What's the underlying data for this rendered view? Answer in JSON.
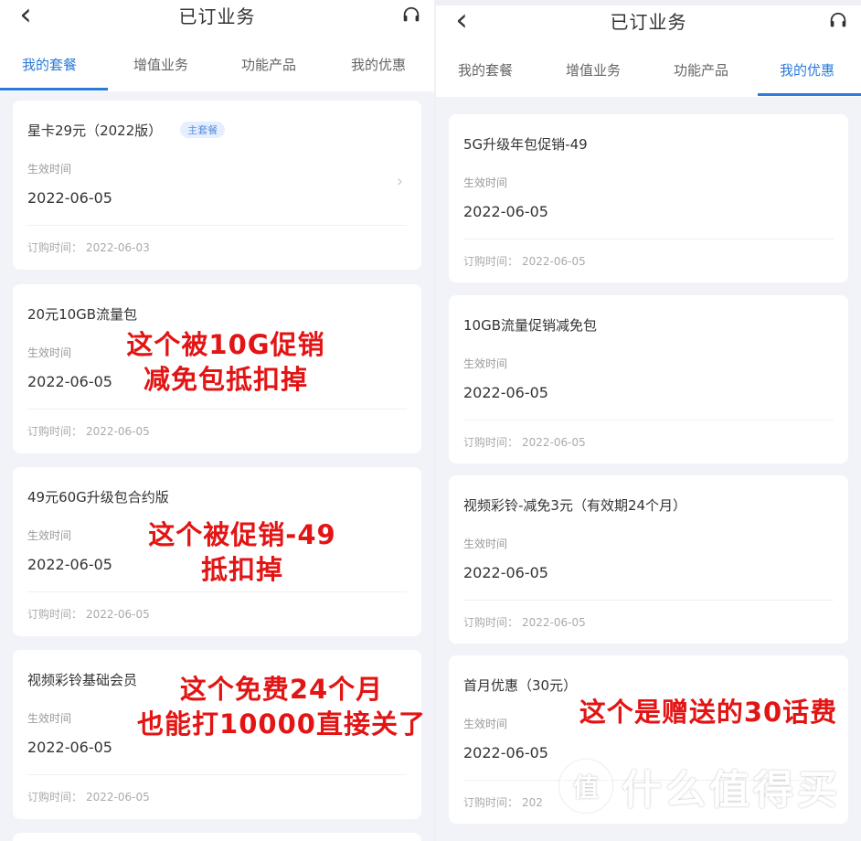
{
  "left": {
    "title": "已订业务",
    "tabs": [
      "我的套餐",
      "增值业务",
      "功能产品",
      "我的优惠"
    ],
    "active_tab": 0,
    "cards": [
      {
        "name": "星卡29元（2022版）",
        "badge": "主套餐",
        "effective_label": "生效时间",
        "effective_date": "2022-06-05",
        "order_label": "订购时间：",
        "order_date": "2022-06-03"
      },
      {
        "name": "20元10GB流量包",
        "effective_label": "生效时间",
        "effective_date": "2022-06-05",
        "order_label": "订购时间：",
        "order_date": "2022-06-05"
      },
      {
        "name": "49元60G升级包合约版",
        "effective_label": "生效时间",
        "effective_date": "2022-06-05",
        "order_label": "订购时间：",
        "order_date": "2022-06-05"
      },
      {
        "name": "视频彩铃基础会员",
        "effective_label": "生效时间",
        "effective_date": "2022-06-05",
        "order_label": "订购时间：",
        "order_date": "2022-06-05"
      }
    ]
  },
  "right": {
    "title": "已订业务",
    "tabs": [
      "我的套餐",
      "增值业务",
      "功能产品",
      "我的优惠"
    ],
    "active_tab": 3,
    "cards": [
      {
        "name": "5G升级年包促销-49",
        "effective_label": "生效时间",
        "effective_date": "2022-06-05",
        "order_label": "订购时间：",
        "order_date": "2022-06-05"
      },
      {
        "name": "10GB流量促销减免包",
        "effective_label": "生效时间",
        "effective_date": "2022-06-05",
        "order_label": "订购时间：",
        "order_date": "2022-06-05"
      },
      {
        "name": "视频彩铃-减免3元（有效期24个月）",
        "effective_label": "生效时间",
        "effective_date": "2022-06-05",
        "order_label": "订购时间：",
        "order_date": "2022-06-05"
      },
      {
        "name": "首月优惠（30元）",
        "effective_label": "生效时间",
        "effective_date": "2022-06-05",
        "order_label": "订购时间：",
        "order_date": "202"
      }
    ]
  },
  "annotations": {
    "a1_line1": "这个被10G促销",
    "a1_line2": "减免包抵扣掉",
    "a2_line1": "这个被促销-49",
    "a2_line2": "抵扣掉",
    "a3_line1": "这个免费24个月",
    "a3_line2": "也能打10000直接关了",
    "a4": "这个是赠送的30话费"
  },
  "watermark": {
    "logo": "值",
    "text": "什么值得买"
  },
  "colors": {
    "accent": "#2b7bd8",
    "annotation": "#e31414",
    "background": "#f1f3f8"
  }
}
